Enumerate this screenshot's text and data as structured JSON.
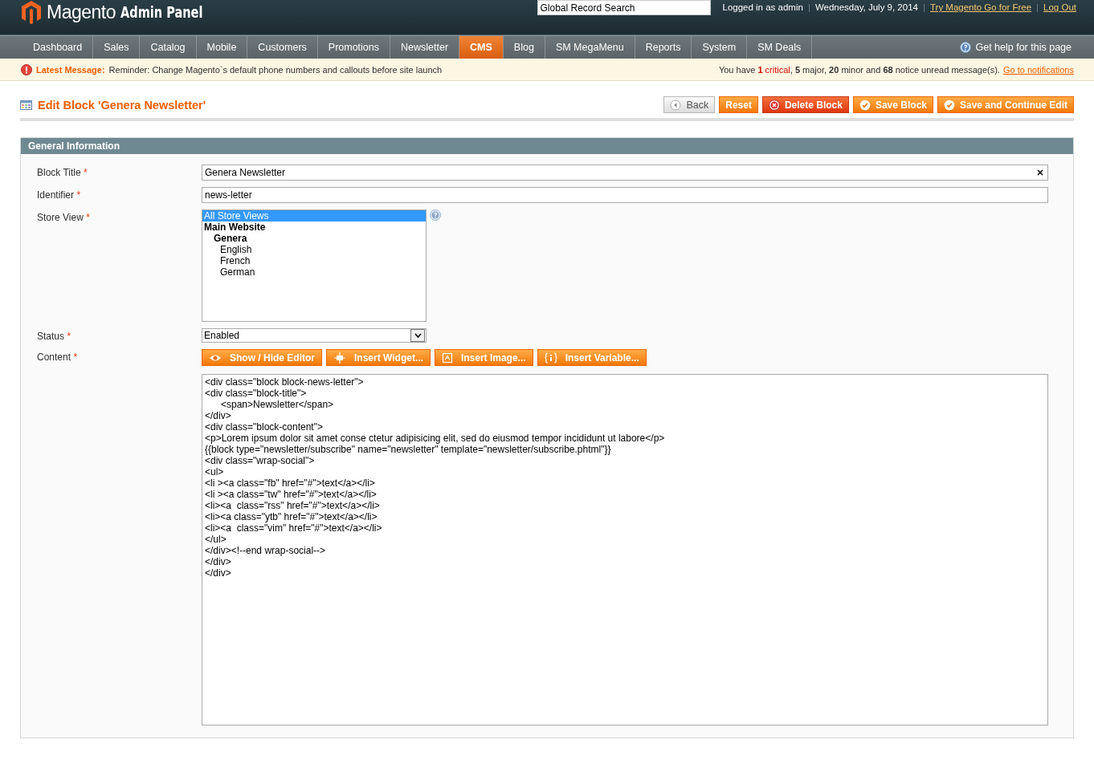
{
  "header": {
    "logo_name": "Magento",
    "logo_tagline": "Admin Panel",
    "search": {
      "placeholder": "Global Record Search"
    },
    "user_info": "Logged in as admin",
    "date": "Wednesday, July 9, 2014",
    "separator": "|",
    "links": [
      "Try Magento Go for Free",
      "Log Out"
    ]
  },
  "nav": {
    "items": [
      {
        "label": "Dashboard",
        "selected": false
      },
      {
        "label": "Sales",
        "selected": false
      },
      {
        "label": "Catalog",
        "selected": false
      },
      {
        "label": "Mobile",
        "selected": false
      },
      {
        "label": "Customers",
        "selected": false
      },
      {
        "label": "Promotions",
        "selected": false
      },
      {
        "label": "Newsletter",
        "selected": false
      },
      {
        "label": "CMS",
        "selected": true
      },
      {
        "label": "Blog",
        "selected": false
      },
      {
        "label": "SM MegaMenu",
        "selected": false
      },
      {
        "label": "Reports",
        "selected": false
      },
      {
        "label": "System",
        "selected": false
      },
      {
        "label": "SM Deals",
        "selected": false
      }
    ],
    "help": "Get help for this page"
  },
  "message": {
    "label": "Latest Message:",
    "text": "Reminder: Change Magento`s default phone numbers and callouts before site launch",
    "summary": [
      {
        "kind": "plain",
        "text": "You have "
      },
      {
        "kind": "critical-bold",
        "text": "1"
      },
      {
        "kind": "critical",
        "text": " critical"
      },
      {
        "kind": "plain",
        "text": ", "
      },
      {
        "kind": "bold",
        "text": "5"
      },
      {
        "kind": "plain",
        "text": " major, "
      },
      {
        "kind": "bold",
        "text": "20"
      },
      {
        "kind": "plain",
        "text": " minor and "
      },
      {
        "kind": "bold",
        "text": "68"
      },
      {
        "kind": "plain",
        "text": " notice unread message(s)."
      }
    ],
    "link": "Go to notifications"
  },
  "page": {
    "title": "Edit Block 'Genera Newsletter'",
    "buttons": [
      {
        "kind": "back",
        "label": "Back"
      },
      {
        "kind": "plain",
        "label": "Reset"
      },
      {
        "kind": "delete",
        "label": "Delete Block"
      },
      {
        "kind": "save",
        "label": "Save Block"
      },
      {
        "kind": "save",
        "label": "Save and Continue Edit"
      }
    ]
  },
  "section": {
    "title": "General Information",
    "block_title": {
      "label": "Block Title",
      "required_mark": "*",
      "value": "Genera Newsletter"
    },
    "identifier": {
      "label": "Identifier",
      "required_mark": "*",
      "value": "news-letter"
    },
    "store_view": {
      "label": "Store View",
      "required_mark": "*",
      "options": [
        {
          "label": "All Store Views",
          "selected": true
        },
        {
          "label": "Main Website",
          "selected": false,
          "children": [
            {
              "label": "Genera",
              "selected": false,
              "children": [
                {
                  "label": "English",
                  "selected": false
                },
                {
                  "label": "French",
                  "selected": false
                },
                {
                  "label": "German",
                  "selected": false
                }
              ]
            }
          ]
        }
      ]
    },
    "status": {
      "label": "Status",
      "required_mark": "*",
      "value": "Enabled"
    },
    "content": {
      "label": "Content",
      "required_mark": "*",
      "buttons": [
        {
          "kind": "eye",
          "label": "Show / Hide Editor"
        },
        {
          "kind": "widget",
          "label": "Insert Widget..."
        },
        {
          "kind": "image",
          "label": "Insert Image..."
        },
        {
          "kind": "variable",
          "label": "Insert Variable..."
        }
      ],
      "lines": [
        "<div class=\"block block-news-letter\">",
        "<div class=\"block-title\">",
        "\t<span>Newsletter</span>",
        "</div>",
        "<div class=\"block-content\">",
        "<p>Lorem ipsum dolor sit amet conse ctetur adipisicing elit, sed do eiusmod tempor incididunt ut labore</p>",
        "{{block type=\"newsletter/subscribe\" name=\"newsletter\" template=\"newsletter/subscribe.phtml\"}}",
        "<div class=\"wrap-social\">",
        "<ul>",
        "<li ><a class=\"fb\" href=\"#\">text</a></li>",
        "<li ><a class=\"tw\" href=\"#\">text</a></li>",
        "<li><a  class=\"rss\" href=\"#\">text</a></li>",
        "<li><a class=\"ytb\" href=\"#\">text</a></li>",
        "<li><a  class=\"vim\" href=\"#\">text</a></li>",
        "</ul>",
        "</div><!--end wrap-social-->",
        "</div>",
        "</div>"
      ]
    }
  }
}
